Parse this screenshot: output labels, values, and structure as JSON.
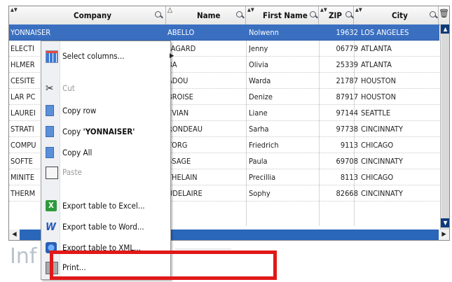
{
  "columns": [
    {
      "label": "Company"
    },
    {
      "label": "Name"
    },
    {
      "label": "First Name"
    },
    {
      "label": "ZIP"
    },
    {
      "label": "City"
    }
  ],
  "rows": [
    {
      "company": "YONNAISER",
      "name": "ABELLO",
      "first": "Nolwenn",
      "zip": "19632",
      "city": "LOS ANGELES",
      "selected": true
    },
    {
      "company": "ELECTI",
      "name": "FAGARD",
      "first": "Jenny",
      "zip": "06779",
      "city": "ATLANTA"
    },
    {
      "company": "HLMER",
      "name": "BA",
      "first": "Olivia",
      "zip": "25339",
      "city": "ATLANTA"
    },
    {
      "company": "CESITE",
      "name": "ADOU",
      "first": "Warda",
      "zip": "21787",
      "city": "HOUSTON"
    },
    {
      "company": "LAR PC",
      "name": "BROISE",
      "first": "Denize",
      "zip": "87917",
      "city": "HOUSTON"
    },
    {
      "company": "LAUREI",
      "name": "EVIAN",
      "first": "Liane",
      "zip": "97144",
      "city": "SEATTLE"
    },
    {
      "company": "STRATI",
      "name": "RONDEAU",
      "first": "Sarha",
      "zip": "97738",
      "city": "CINCINNATY"
    },
    {
      "company": "COMPU",
      "name": "TORG",
      "first": "Friedrich",
      "zip": "9113",
      "city": "CHICAGO"
    },
    {
      "company": "SOFTE",
      "name": "SSAGE",
      "first": "Paula",
      "zip": "69708",
      "city": "CINCINNATY"
    },
    {
      "company": "MINITE",
      "name": "THELAIN",
      "first": "Precillia",
      "zip": "8113",
      "city": "CHICAGO"
    },
    {
      "company": "THERM",
      "name": "UDELAIRE",
      "first": "Sophy",
      "zip": "82668",
      "city": "CINCINNATY"
    }
  ],
  "menu": {
    "select_columns": "Select columns...",
    "cut": "Cut",
    "copy_row": "Copy row",
    "copy_cell_prefix": "Copy ",
    "copy_cell_value": "'YONNAISER'",
    "copy_all": "Copy All",
    "paste": "Paste",
    "export_excel": "Export table to Excel...",
    "export_word": "Export table to Word...",
    "export_xml": "Export table to XML...",
    "print": "Print..."
  },
  "info_text": "Inf",
  "colors": {
    "selection": "#3a6fc0",
    "highlight_border": "#e11818",
    "scrollbar": "#2a66b9"
  },
  "icons": {
    "filter": "magnifier-icon",
    "sort": "sort-arrow-icon",
    "trash": "trash-icon"
  }
}
